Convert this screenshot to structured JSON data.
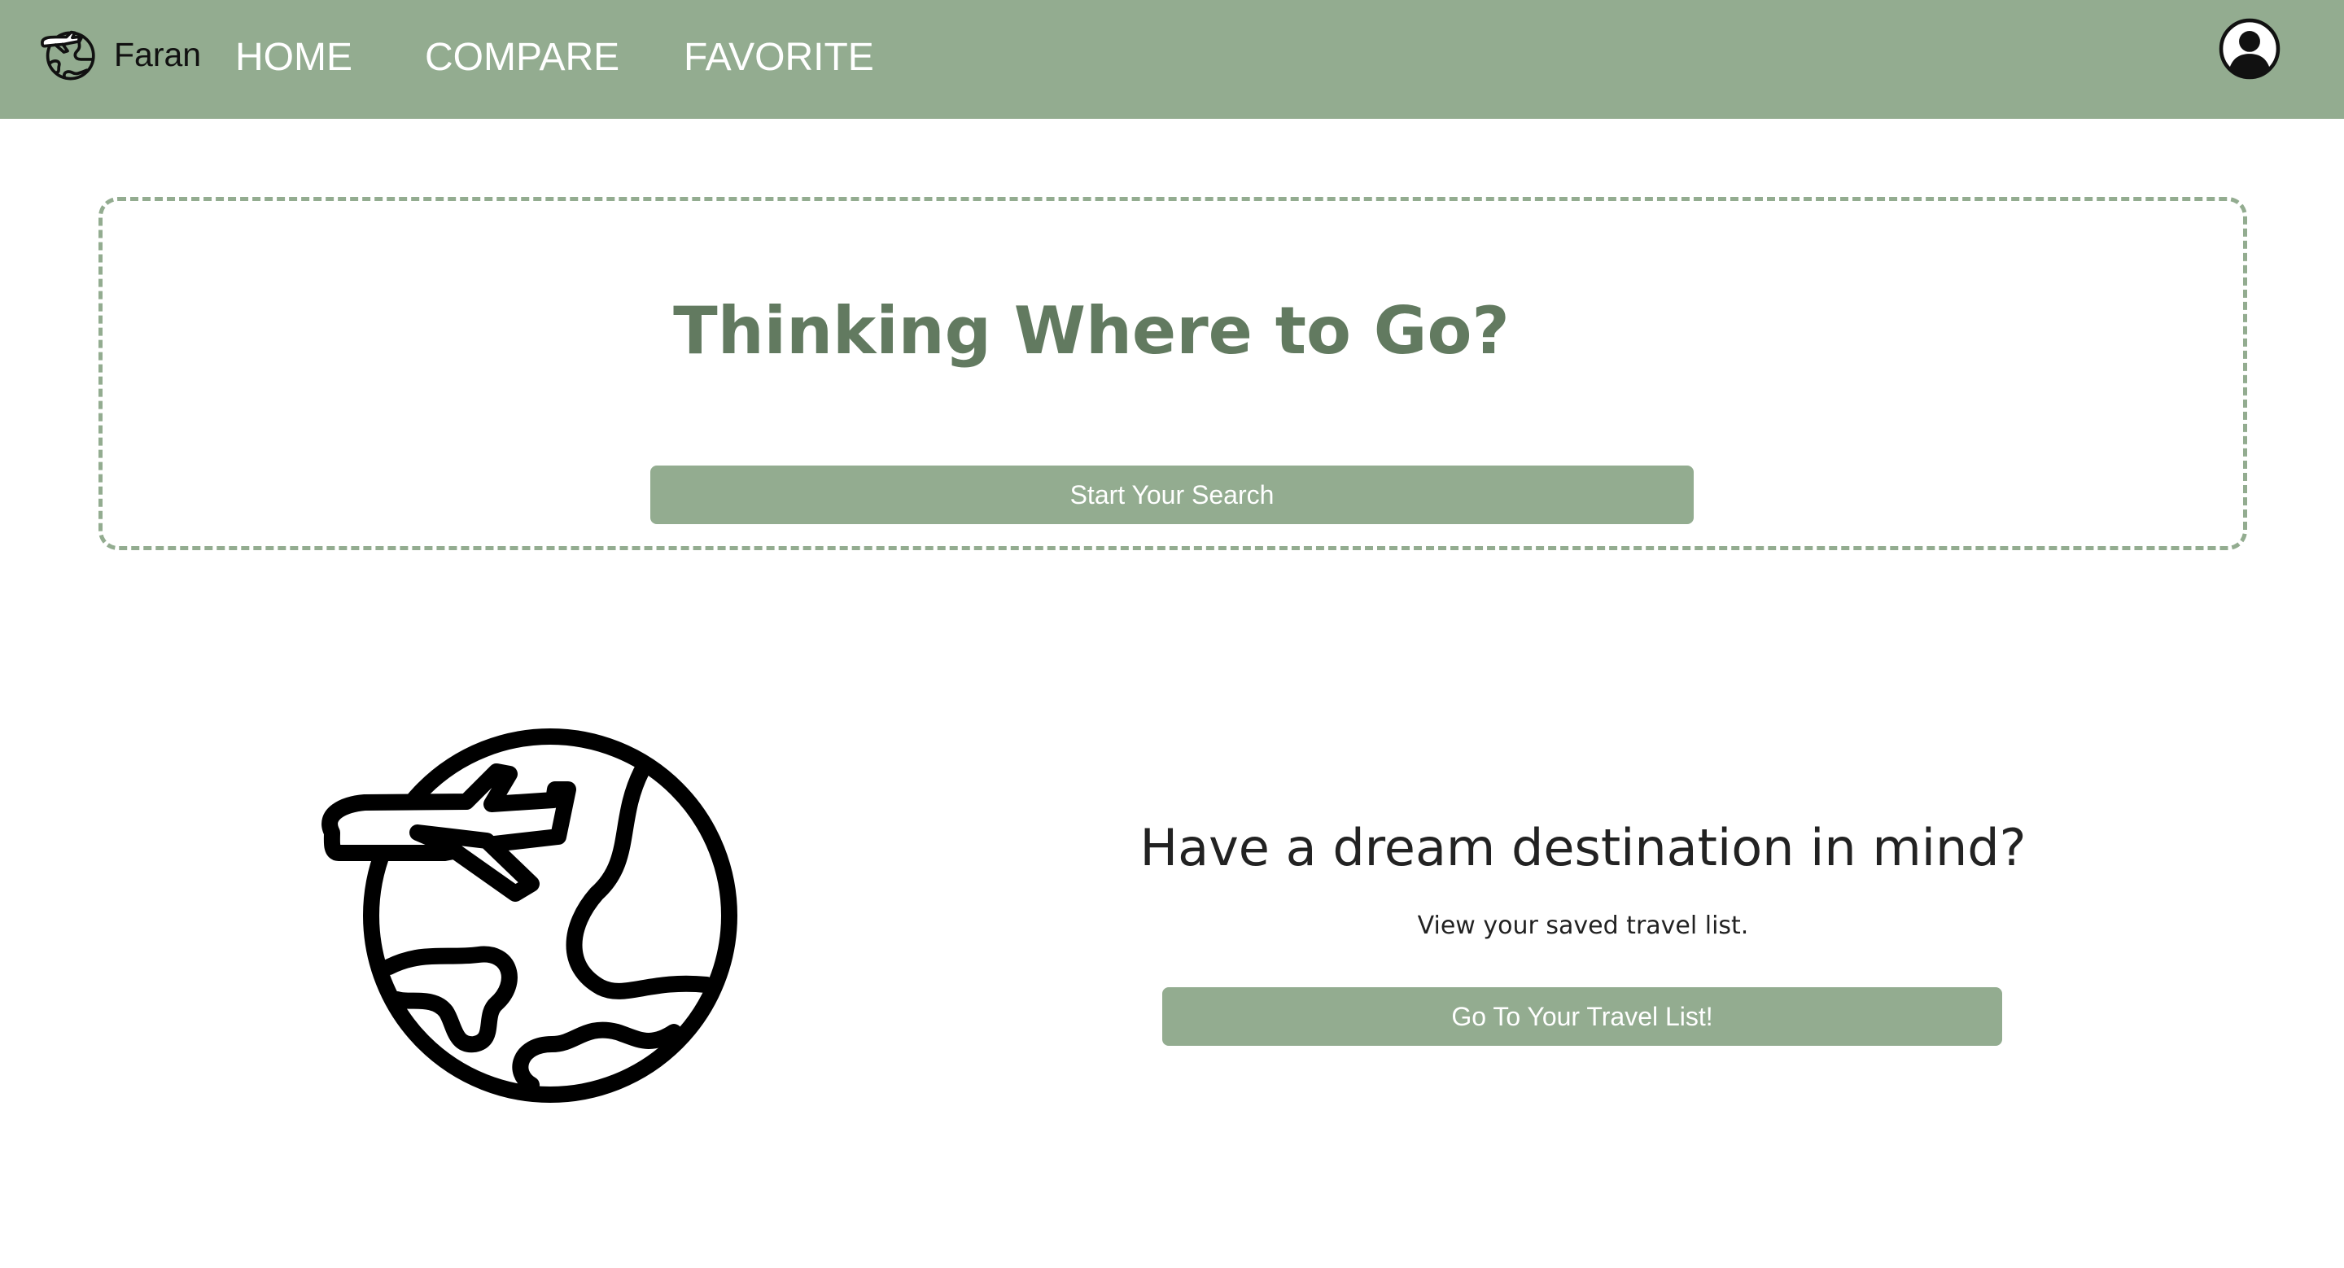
{
  "header": {
    "brand_name": "Faran",
    "nav": {
      "home": "HOME",
      "compare": "COMPARE",
      "favorite": "FAVORITE"
    },
    "logo_icon": "globe-airplane-icon",
    "account_icon": "user-circle-icon"
  },
  "hero": {
    "title": "Thinking Where to Go?",
    "button_label": "Start Your Search"
  },
  "dream": {
    "illustration_icon": "globe-airplane-icon",
    "title": "Have a dream destination in mind?",
    "subtitle": "View your saved travel list.",
    "button_label": "Go To Your Travel List!"
  },
  "colors": {
    "nav_background": "#93ac90",
    "accent": "#93ac90",
    "heading_green": "#627a60",
    "text_dark": "#222222",
    "button_text": "#ffffff"
  }
}
